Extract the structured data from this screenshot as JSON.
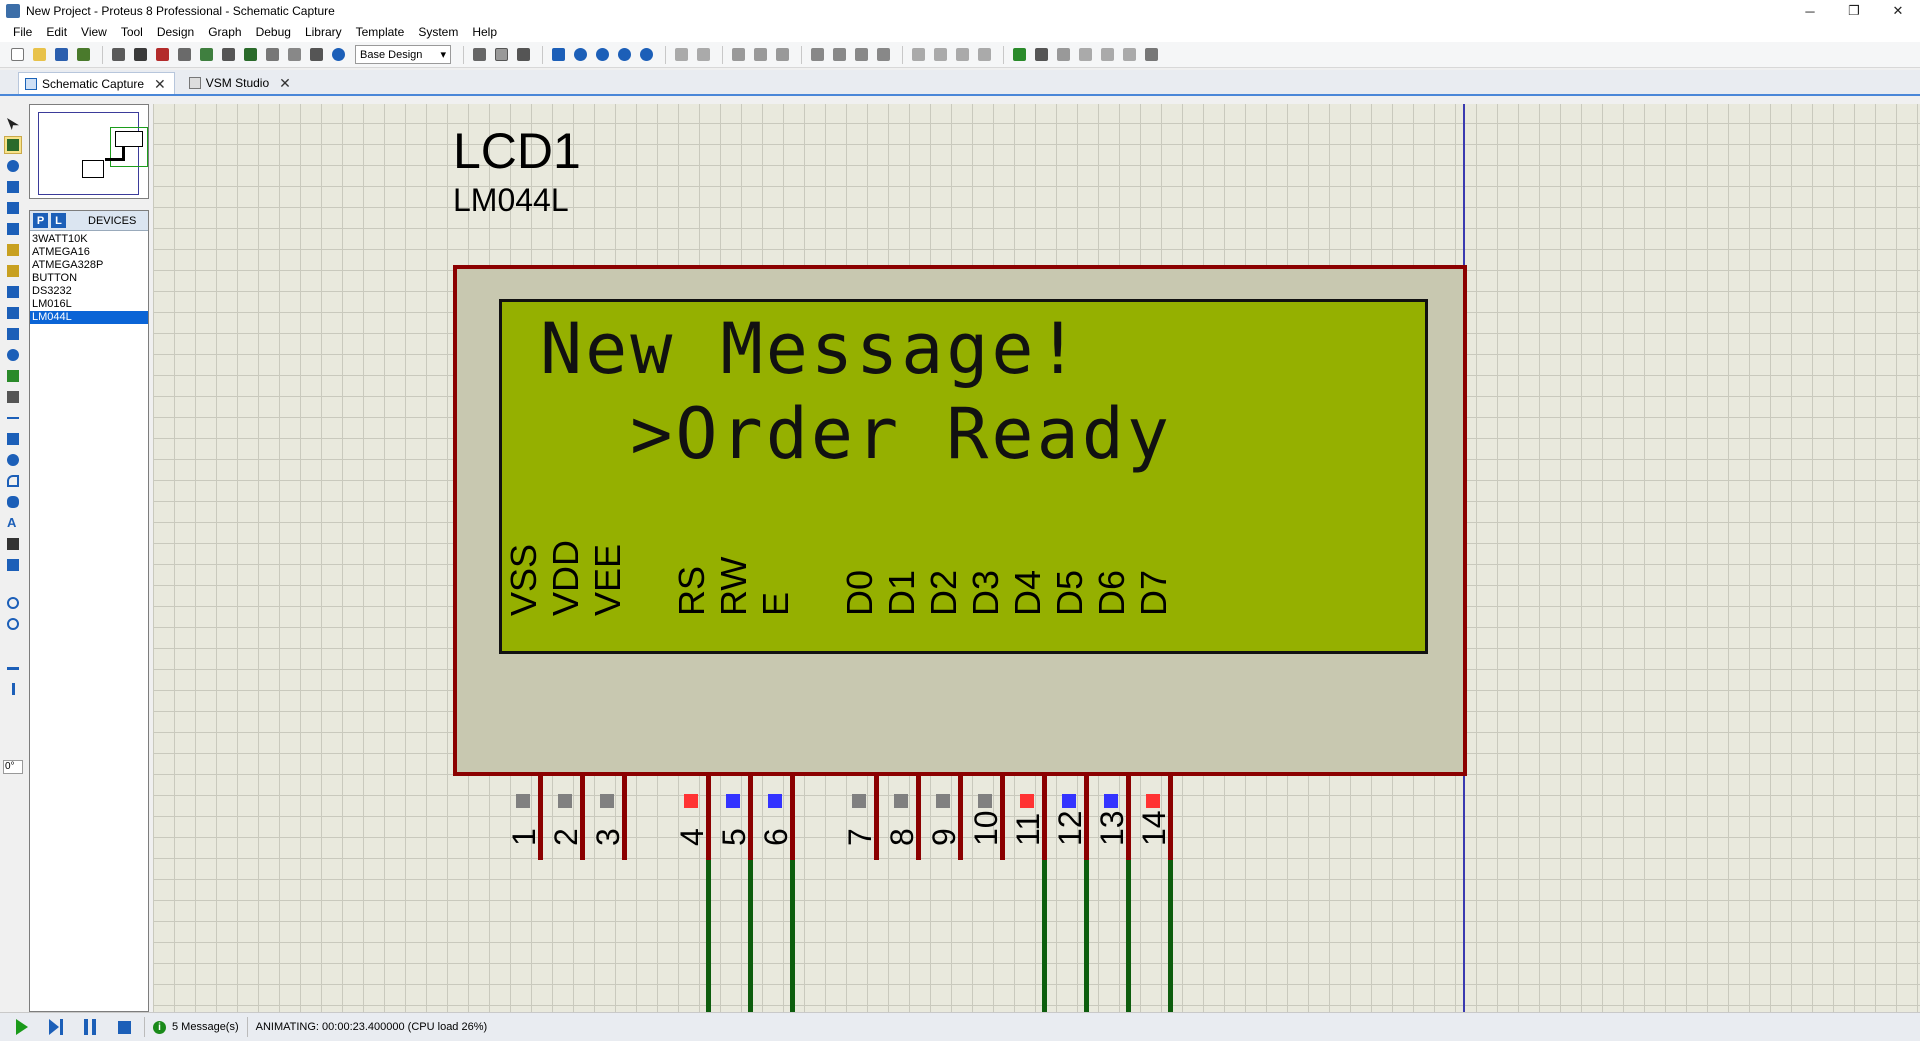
{
  "window": {
    "title": "New Project - Proteus 8 Professional - Schematic Capture",
    "minimize": "─",
    "restore": "❐",
    "close": "✕"
  },
  "menu": [
    "File",
    "Edit",
    "View",
    "Tool",
    "Design",
    "Graph",
    "Debug",
    "Library",
    "Template",
    "System",
    "Help"
  ],
  "toolbar": {
    "design_select": "Base Design"
  },
  "tabs": [
    {
      "label": "Schematic Capture",
      "active": true
    },
    {
      "label": "VSM Studio",
      "active": false
    }
  ],
  "devices": {
    "mode_p": "P",
    "mode_l": "L",
    "header": "DEVICES",
    "items": [
      "3WATT10K",
      "ATMEGA16",
      "ATMEGA328P",
      "BUTTON",
      "DS3232",
      "LM016L",
      "LM044L"
    ],
    "selected": "LM044L"
  },
  "rotation": "0°",
  "lcd": {
    "ref": "LCD1",
    "part": "LM044L",
    "line1": "New Message!",
    "line2": "  >Order Ready",
    "pin_names": [
      "VSS",
      "VDD",
      "VEE",
      "RS",
      "RW",
      "E",
      "D0",
      "D1",
      "D2",
      "D3",
      "D4",
      "D5",
      "D6",
      "D7"
    ],
    "pin_numbers": [
      "1",
      "2",
      "3",
      "4",
      "5",
      "6",
      "7",
      "8",
      "9",
      "10",
      "11",
      "12",
      "13",
      "14"
    ],
    "pin_states": [
      "grey",
      "grey",
      "grey",
      "red",
      "blue",
      "blue",
      "grey",
      "grey",
      "grey",
      "grey",
      "red",
      "blue",
      "blue",
      "red"
    ]
  },
  "colors": {
    "lcd_screen": "#95b000",
    "pin_high": "#ff3333",
    "pin_low": "#3333ff",
    "pin_float": "#808080",
    "wire": "#0d5d0d",
    "component_outline": "#8b0000"
  },
  "status": {
    "messages": "5 Message(s)",
    "animating": "ANIMATING: 00:00:23.400000 (CPU load 26%)"
  }
}
